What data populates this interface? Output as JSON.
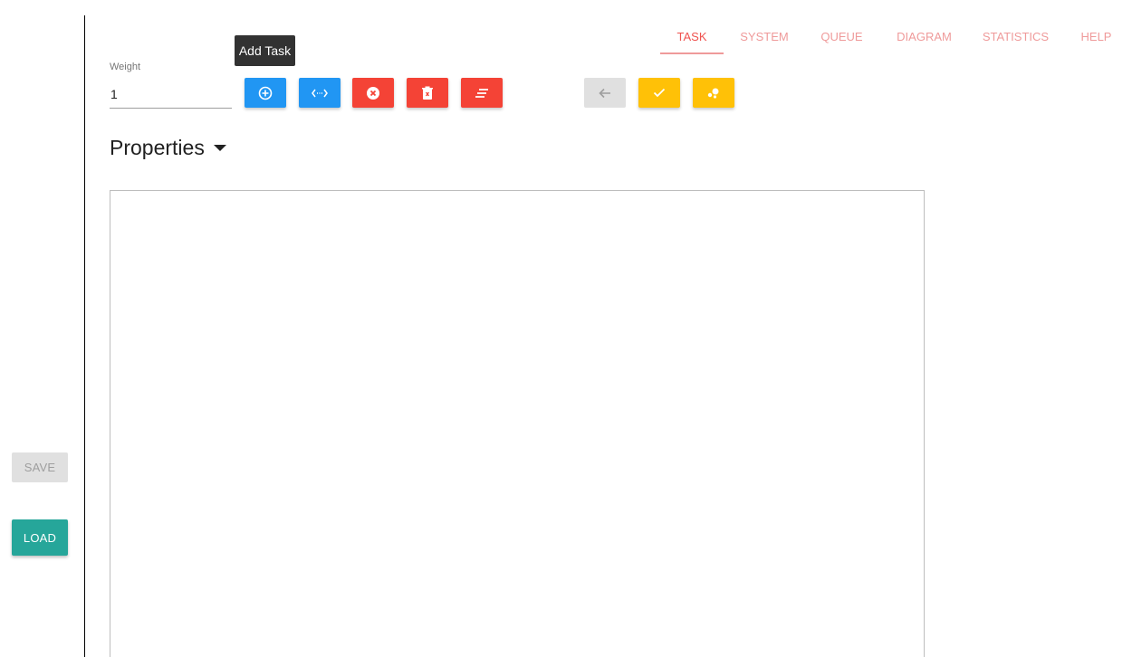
{
  "sidebar": {
    "save_label": "SAVE",
    "load_label": "LOAD"
  },
  "tabs": [
    {
      "label": "TASK",
      "active": true
    },
    {
      "label": "SYSTEM",
      "active": false
    },
    {
      "label": "QUEUE",
      "active": false
    },
    {
      "label": "DIAGRAM",
      "active": false
    },
    {
      "label": "STATISTICS",
      "active": false
    },
    {
      "label": "HELP",
      "active": false
    }
  ],
  "weight": {
    "label": "Weight",
    "value": "1"
  },
  "tooltip": {
    "text": "Add Task"
  },
  "toolbar": {
    "buttons": [
      {
        "icon": "add-circle-icon",
        "color": "#2196f3"
      },
      {
        "icon": "connect-arrows-icon",
        "color": "#2196f3"
      },
      {
        "icon": "cancel-circle-icon",
        "color": "#f44336"
      },
      {
        "icon": "delete-icon",
        "color": "#f44336"
      },
      {
        "icon": "clear-all-icon",
        "color": "#f44336"
      },
      {
        "icon": "arrow-back-icon",
        "color": "#e0e0e0"
      },
      {
        "icon": "check-icon",
        "color": "#ffc107"
      },
      {
        "icon": "bubbles-icon",
        "color": "#ffc107"
      }
    ]
  },
  "properties": {
    "title": "Properties"
  }
}
